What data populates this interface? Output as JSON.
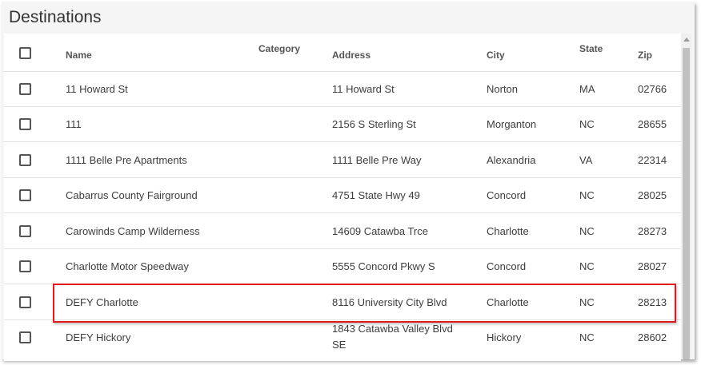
{
  "page": {
    "title": "Destinations"
  },
  "columns": {
    "name": "Name",
    "category": "Category",
    "address": "Address",
    "city": "City",
    "state": "State",
    "zip": "Zip"
  },
  "rows": [
    {
      "name": "11 Howard St",
      "address": "11 Howard St",
      "city": "Norton",
      "state": "MA",
      "zip": "02766"
    },
    {
      "name": "111",
      "address": "2156 S Sterling St",
      "city": "Morganton",
      "state": "NC",
      "zip": "28655"
    },
    {
      "name": "1111 Belle Pre Apartments",
      "address": "1111 Belle Pre Way",
      "city": "Alexandria",
      "state": "VA",
      "zip": "22314"
    },
    {
      "name": "Cabarrus County Fairground",
      "address": "4751 State Hwy 49",
      "city": "Concord",
      "state": "NC",
      "zip": "28025"
    },
    {
      "name": "Carowinds Camp Wilderness",
      "address": "14609 Catawba Trce",
      "city": "Charlotte",
      "state": "NC",
      "zip": "28273"
    },
    {
      "name": "Charlotte Motor Speedway",
      "address": "5555 Concord Pkwy S",
      "city": "Concord",
      "state": "NC",
      "zip": "28027"
    },
    {
      "name": "DEFY Charlotte",
      "address": "8116 University City Blvd",
      "city": "Charlotte",
      "state": "NC",
      "zip": "28213"
    },
    {
      "name": "DEFY Hickory",
      "address": "1843 Catawba Valley Blvd SE",
      "city": "Hickory",
      "state": "NC",
      "zip": "28602"
    }
  ],
  "highlight_color": "#e11b1b"
}
